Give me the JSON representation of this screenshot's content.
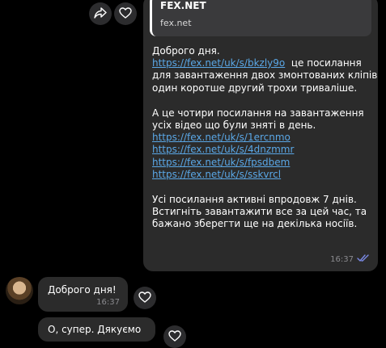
{
  "header": {
    "share_icon": "share-icon",
    "heart_icon": "heart-icon"
  },
  "outgoing": {
    "preview": {
      "title": "FEX.NET",
      "domain": "fex.net"
    },
    "lines": {
      "greeting": "Доброго дня.",
      "link1": "https://fex.net/uk/s/bkzly9o",
      "line2_rest": "  це посилання",
      "line3": "для завантаження двох змонтованих кліпів",
      "line4": "один коротше другий трохи триваліше.",
      "line5": "А це чотири посилання на завантаження",
      "line6": "усіх відео що були зняті в день.",
      "link2": "https://fex.net/uk/s/1ercnmo",
      "link3": "https://fex.net/uk/s/4dnzmmr",
      "link4": "https://fex.net/uk/s/fpsdbem",
      "link5": "https://fex.net/uk/s/sskvrcl",
      "line7": "Усі посилання активні впродовж 7 днів.",
      "line8": "Встигніть завантажити все за цей час, та",
      "line9": "бажано зберегти ще на декілька носіїв."
    },
    "time": "16:37",
    "status_icon": "double-check-icon"
  },
  "incoming": [
    {
      "text": "Доброго дня!",
      "time": "16:37"
    },
    {
      "text": "О, супер. Дякуємо"
    }
  ],
  "colors": {
    "background": "#000000",
    "bubble": "#2b2b2b",
    "link": "#5aa7e6",
    "check": "#7b8ae6"
  }
}
